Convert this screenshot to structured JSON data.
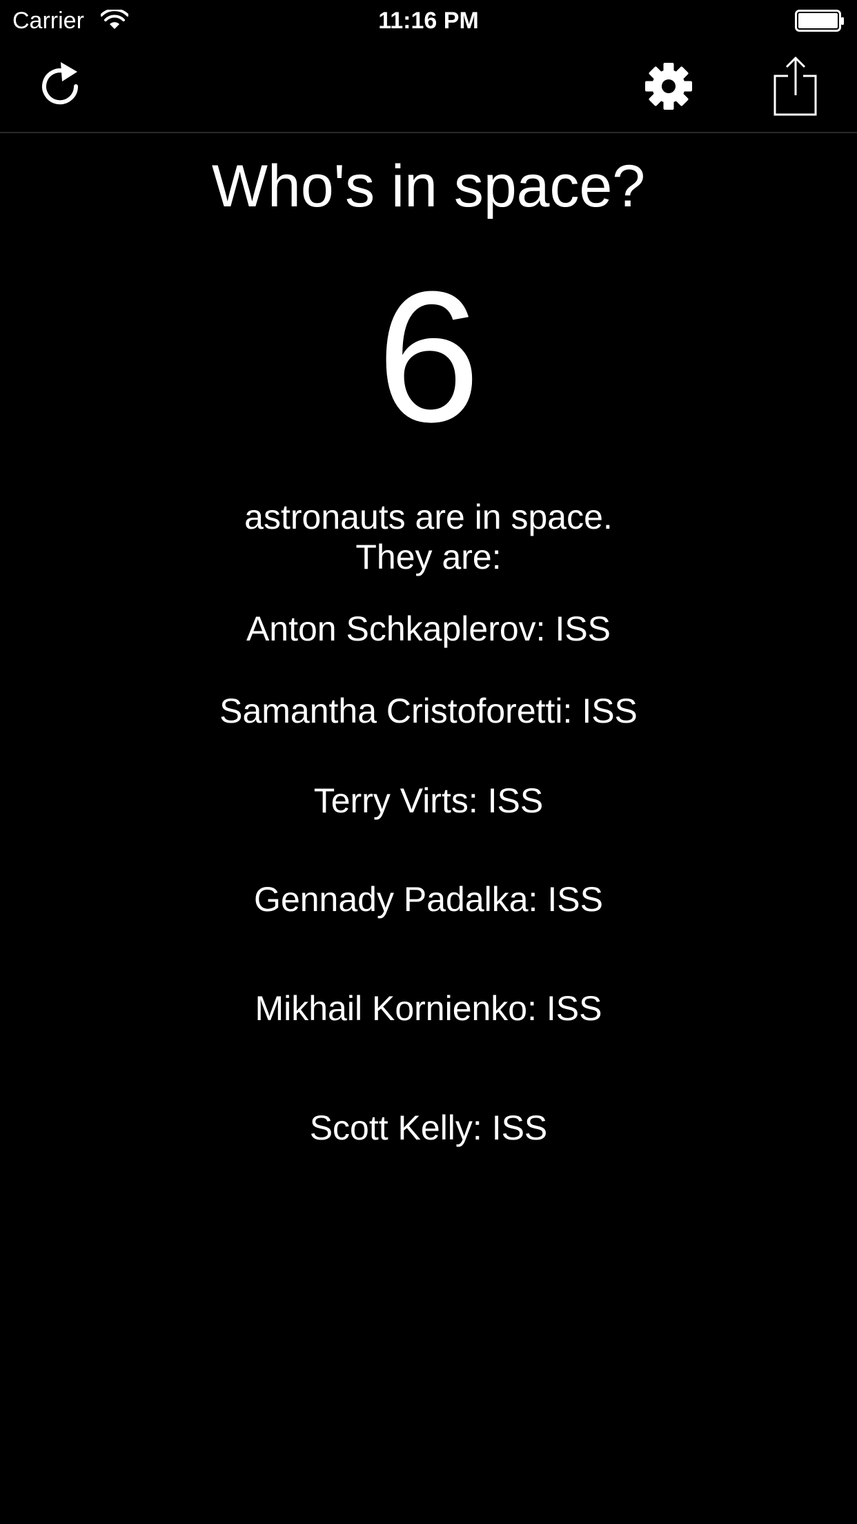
{
  "status_bar": {
    "carrier": "Carrier",
    "time": "11:16 PM",
    "wifi_icon": "wifi-icon",
    "battery_icon": "battery-icon"
  },
  "toolbar": {
    "refresh_icon": "refresh-icon",
    "settings_icon": "gear-icon",
    "share_icon": "share-icon"
  },
  "main": {
    "title": "Who's in space?",
    "count": "6",
    "subtitle_line1": "astronauts are in space.",
    "subtitle_line2": "They are:",
    "astronauts": [
      "Anton Schkaplerov: ISS",
      "Samantha Cristoforetti: ISS",
      "Terry Virts: ISS",
      "Gennady Padalka: ISS",
      "Mikhail Kornienko: ISS",
      "Scott Kelly: ISS"
    ]
  },
  "colors": {
    "background": "#000000",
    "text": "#ffffff"
  }
}
